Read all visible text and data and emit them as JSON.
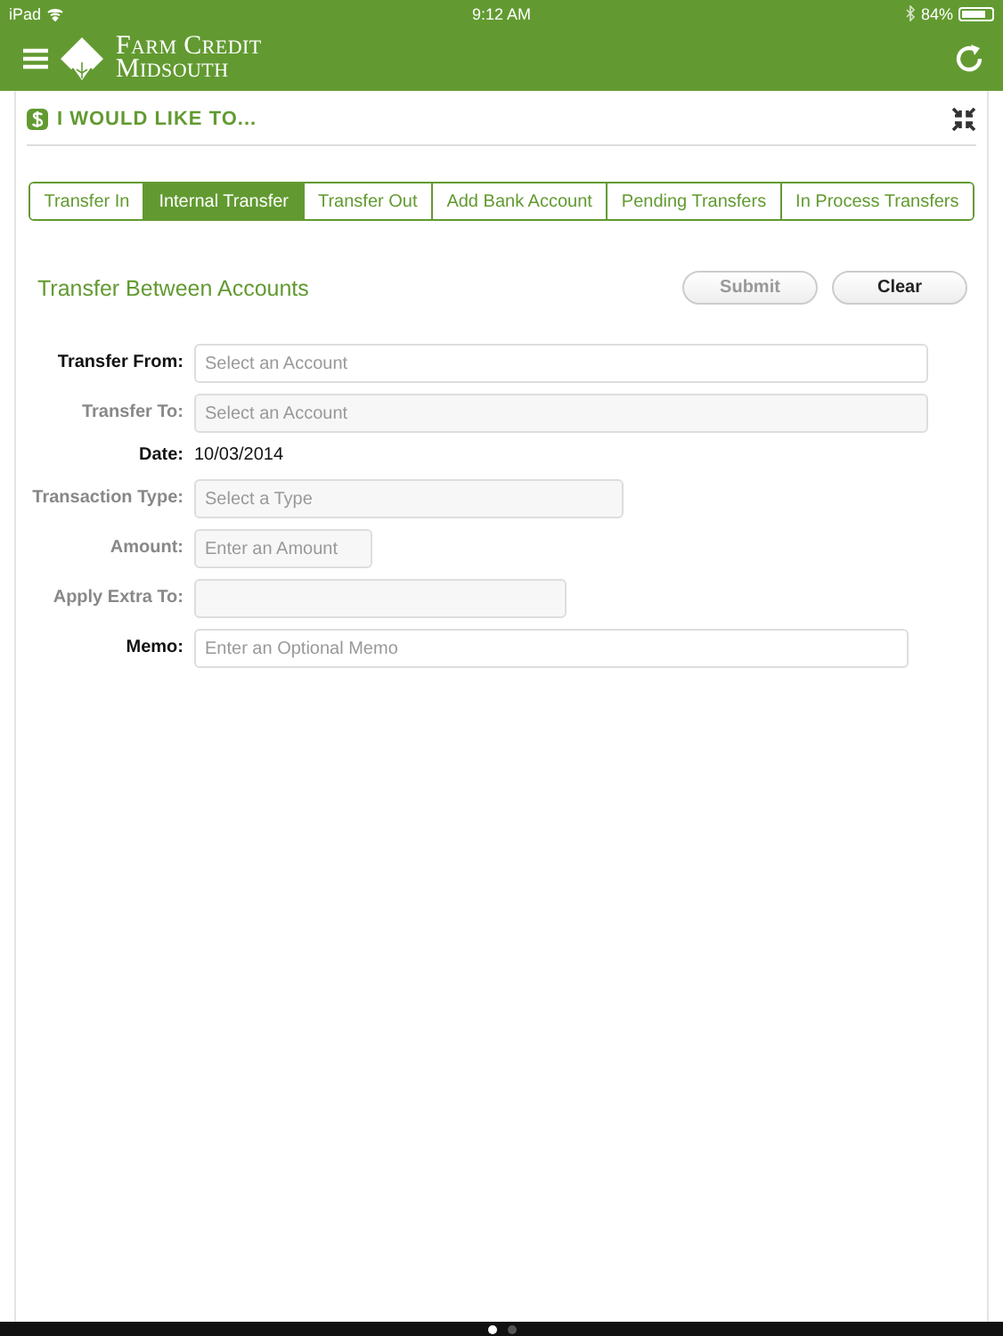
{
  "status_bar": {
    "carrier": "iPad",
    "time": "9:12 AM",
    "battery": "84%"
  },
  "app_bar": {
    "logo_line_1": "Farm Credit",
    "logo_line_2": "Midsouth"
  },
  "section": {
    "title": "I WOULD LIKE TO..."
  },
  "tabs": [
    {
      "label": "Transfer In",
      "selected": false
    },
    {
      "label": "Internal Transfer",
      "selected": true
    },
    {
      "label": "Transfer Out",
      "selected": false
    },
    {
      "label": "Add Bank Account",
      "selected": false
    },
    {
      "label": "Pending Transfers",
      "selected": false
    },
    {
      "label": "In Process Transfers",
      "selected": false
    }
  ],
  "form": {
    "title": "Transfer Between Accounts",
    "buttons": [
      {
        "label": "Submit",
        "disabled": true
      },
      {
        "label": "Clear",
        "disabled": false
      }
    ],
    "rows": [
      {
        "kind": "field",
        "label": "Transfer From:",
        "placeholder": "Select an Account",
        "disabled": false
      },
      {
        "kind": "field",
        "label": "Transfer To:",
        "placeholder": "Select an Account",
        "disabled": true
      },
      {
        "kind": "text",
        "label": "Date:",
        "value": "10/03/2014",
        "disabled": false
      },
      {
        "kind": "field",
        "label": "Transaction Type:",
        "placeholder": "Select a Type",
        "disabled": true
      },
      {
        "kind": "field",
        "label": "Amount:",
        "placeholder": "Enter an Amount",
        "disabled": true
      },
      {
        "kind": "field",
        "label": "Apply Extra To:",
        "disabled": true
      },
      {
        "kind": "field",
        "label": "Memo:",
        "placeholder": "Enter an Optional Memo",
        "disabled": false
      }
    ]
  },
  "page_dots": [
    {
      "selected": true
    },
    {
      "selected": false
    }
  ]
}
